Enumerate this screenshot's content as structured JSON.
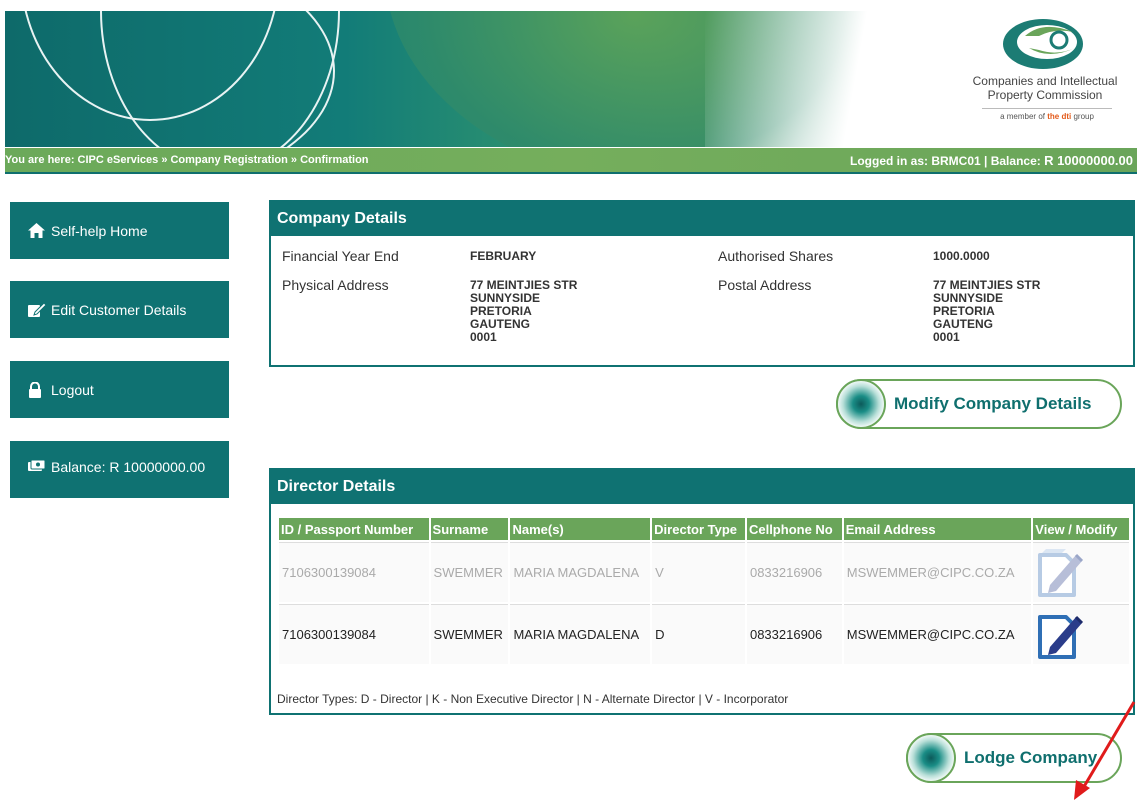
{
  "header": {
    "logo_line1": "Companies and Intellectual",
    "logo_line2": "Property Commission",
    "logo_member_prefix": "a member of",
    "logo_member_brand": "the dti",
    "logo_member_suffix": "group"
  },
  "breadcrumb": {
    "text": "You are here: CIPC eServices » Company Registration » Confirmation",
    "login_prefix": "Logged in as: BRMC01 | Balance: ",
    "login_balance": "R 10000000.00"
  },
  "menu": {
    "home": "Self-help Home",
    "edit_customer": "Edit Customer Details",
    "logout": "Logout",
    "balance": "Balance: R 10000000.00"
  },
  "company": {
    "title": "Company Details",
    "fye_label": "Financial Year End",
    "fye_value": "FEBRUARY",
    "shares_label": "Authorised Shares",
    "shares_value": "1000.0000",
    "phys_label": "Physical Address",
    "phys_lines": [
      "77 MEINTJIES STR",
      "SUNNYSIDE",
      "PRETORIA",
      "GAUTENG",
      "0001"
    ],
    "postal_label": "Postal Address",
    "postal_lines": [
      "77 MEINTJIES STR",
      "SUNNYSIDE",
      "PRETORIA",
      "GAUTENG",
      "0001"
    ],
    "modify_button": "Modify Company Details"
  },
  "directors": {
    "title": "Director Details",
    "columns": [
      "ID / Passport Number",
      "Surname",
      "Name(s)",
      "Director Type",
      "Cellphone No",
      "Email Address",
      "View / Modify"
    ],
    "rows": [
      {
        "id": "7106300139084",
        "surname": "SWEMMER",
        "names": "MARIA MAGDALENA",
        "type": "V",
        "cell": "0833216906",
        "email": "MSWEMMER@CIPC.CO.ZA"
      },
      {
        "id": "7106300139084",
        "surname": "SWEMMER",
        "names": "MARIA MAGDALENA",
        "type": "D",
        "cell": "0833216906",
        "email": "MSWEMMER@CIPC.CO.ZA"
      }
    ],
    "types_legend": "Director Types: D - Director | K - Non Executive Director | N - Alternate Director | V - Incorporator"
  },
  "lodge_button": "Lodge Company",
  "colors": {
    "teal": "#0f7272",
    "green": "#6aa55a",
    "annotation_arrow": "#e01b1b"
  }
}
